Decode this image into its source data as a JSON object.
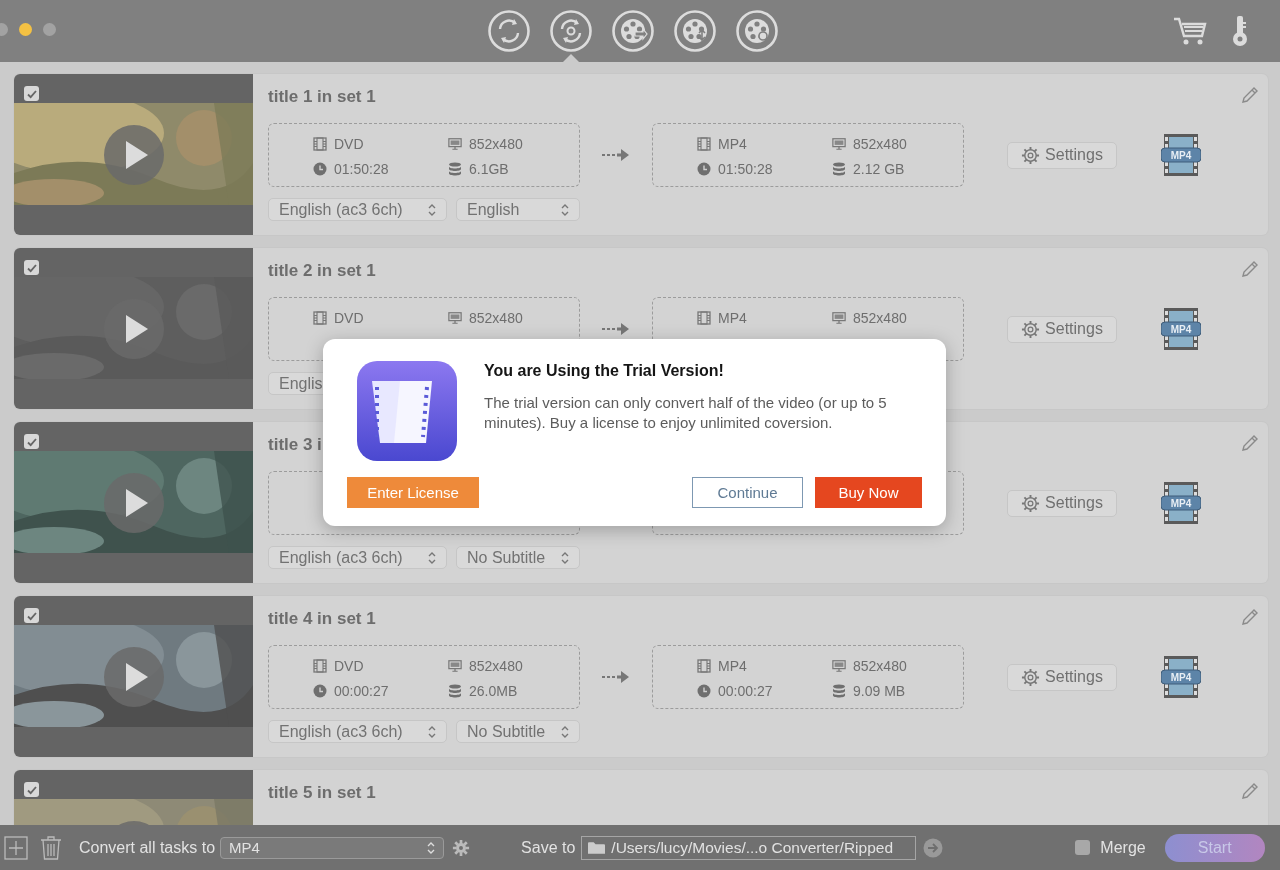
{
  "toolbar": {
    "tools": [
      {
        "kind": "convert",
        "selected": false
      },
      {
        "kind": "rip",
        "selected": true
      },
      {
        "kind": "download",
        "selected": false
      },
      {
        "kind": "compress",
        "selected": false
      },
      {
        "kind": "edit",
        "selected": false
      }
    ]
  },
  "tasks": [
    {
      "checked": true,
      "title": "title 1 in set 1",
      "source": {
        "format": "DVD",
        "resolution": "852x480",
        "duration": "01:50:28",
        "size": "6.1GB"
      },
      "target": {
        "format": "MP4",
        "resolution": "852x480",
        "duration": "01:50:28",
        "size": "2.12 GB"
      },
      "audio": "English (ac3 6ch)",
      "subtitle": "English",
      "settings": "Settings",
      "badge": "MP4"
    },
    {
      "checked": true,
      "title": "title 2 in set 1",
      "source": {
        "format": "DVD",
        "resolution": "852x480"
      },
      "target": {
        "format": "MP4",
        "resolution": "852x480"
      },
      "audio": "Englis",
      "settings": "Settings",
      "badge": "MP4"
    },
    {
      "checked": true,
      "title": "title 3 i",
      "audio": "English (ac3 6ch)",
      "subtitle": "No Subtitle",
      "settings": "Settings",
      "badge": "MP4"
    },
    {
      "checked": true,
      "title": "title 4 in set 1",
      "source": {
        "format": "DVD",
        "resolution": "852x480",
        "duration": "00:00:27",
        "size": "26.0MB"
      },
      "target": {
        "format": "MP4",
        "resolution": "852x480",
        "duration": "00:00:27",
        "size": "9.09 MB"
      },
      "audio": "English (ac3 6ch)",
      "subtitle": "No Subtitle",
      "settings": "Settings",
      "badge": "MP4"
    },
    {
      "checked": true,
      "title": "title 5 in set 1"
    }
  ],
  "bottom_bar": {
    "convert_label": "Convert all tasks to",
    "format": "MP4",
    "save_label": "Save to",
    "path": "/Users/lucy/Movies/...o Converter/Ripped",
    "merge": {
      "label": "Merge",
      "checked": false
    },
    "start": "Start"
  },
  "dialog": {
    "title": "You are Using the Trial Version!",
    "message": "The trial version can only convert half of the video (or up to 5 minutes). Buy a license to enjoy unlimited coversion.",
    "buttons": [
      {
        "label": "Enter License",
        "kind": "license"
      },
      {
        "label": "Continue",
        "kind": "secondary"
      },
      {
        "label": "Buy Now",
        "kind": "primary"
      }
    ]
  }
}
